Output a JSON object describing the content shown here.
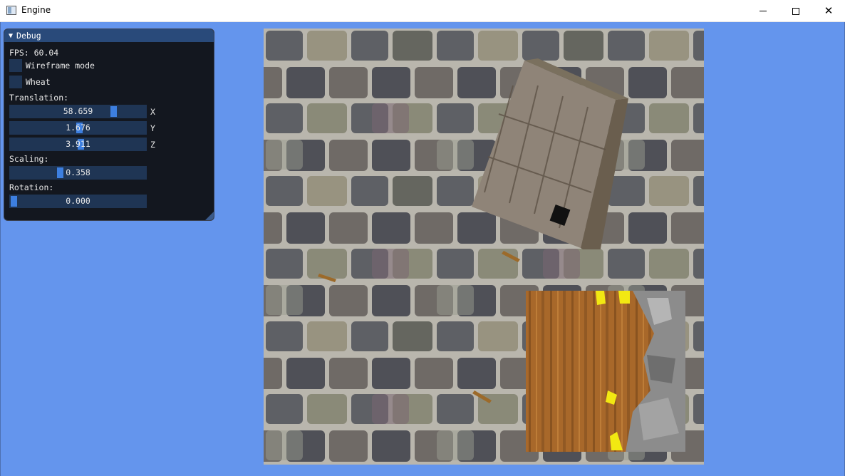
{
  "window": {
    "title": "Engine",
    "icon": "app-window-icon",
    "minimize_icon": "minimize-icon",
    "maximize_icon": "maximize-icon",
    "close_glyph": "✕"
  },
  "debug": {
    "title": "Debug",
    "collapse_glyph": "▼",
    "fps": "FPS: 60.04",
    "wireframe_label": "Wireframe mode",
    "wheat_label": "Wheat",
    "translation_label": "Translation:",
    "translation": [
      {
        "value": "58.659",
        "axis": "X",
        "level": 0.78
      },
      {
        "value": "1.676",
        "axis": "Y",
        "level": 0.51
      },
      {
        "value": "3.911",
        "axis": "Z",
        "level": 0.52
      }
    ],
    "scaling_label": "Scaling:",
    "scaling": {
      "value": "0.358",
      "level": 0.36
    },
    "rotation_label": "Rotation:",
    "rotation": {
      "value": "0.000",
      "level": 0.0
    }
  },
  "colors": {
    "background": "#6495ed",
    "panel": "#101216",
    "panel_header": "#294a7a",
    "frame": "#1f3554",
    "slider_grab": "#3d7fe0"
  }
}
